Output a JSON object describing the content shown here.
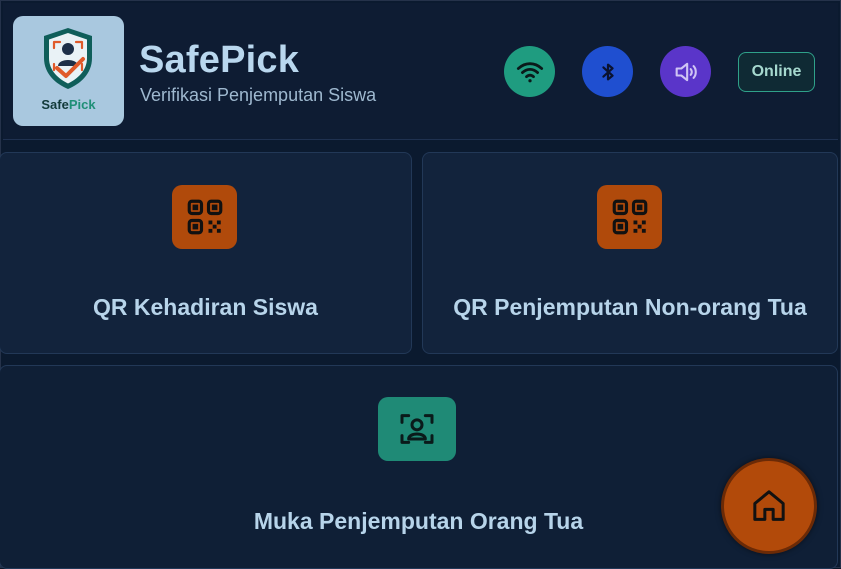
{
  "header": {
    "logo": {
      "brand_prefix": "Safe",
      "brand_suffix": "Pick"
    },
    "title": "SafePick",
    "subtitle": "Verifikasi Penjemputan Siswa",
    "status_icons": [
      "wifi-icon",
      "bluetooth-icon",
      "volume-icon"
    ],
    "online_label": "Online"
  },
  "cards": [
    {
      "label": "QR Kehadiran Siswa",
      "icon": "qr-code-icon"
    },
    {
      "label": "QR Penjemputan Non-orang Tua",
      "icon": "qr-code-icon"
    },
    {
      "label": "Muka Penjemputan Orang Tua",
      "icon": "face-scan-icon"
    }
  ],
  "fab": {
    "icon": "home-icon"
  },
  "colors": {
    "background": "#0b1a2f",
    "accent_orange": "#b04a0b",
    "accent_teal": "#1f8a76",
    "wifi": "#1f9c80",
    "bluetooth": "#1f4fd0",
    "volume": "#5a35c9",
    "text": "#b7d4ea"
  }
}
